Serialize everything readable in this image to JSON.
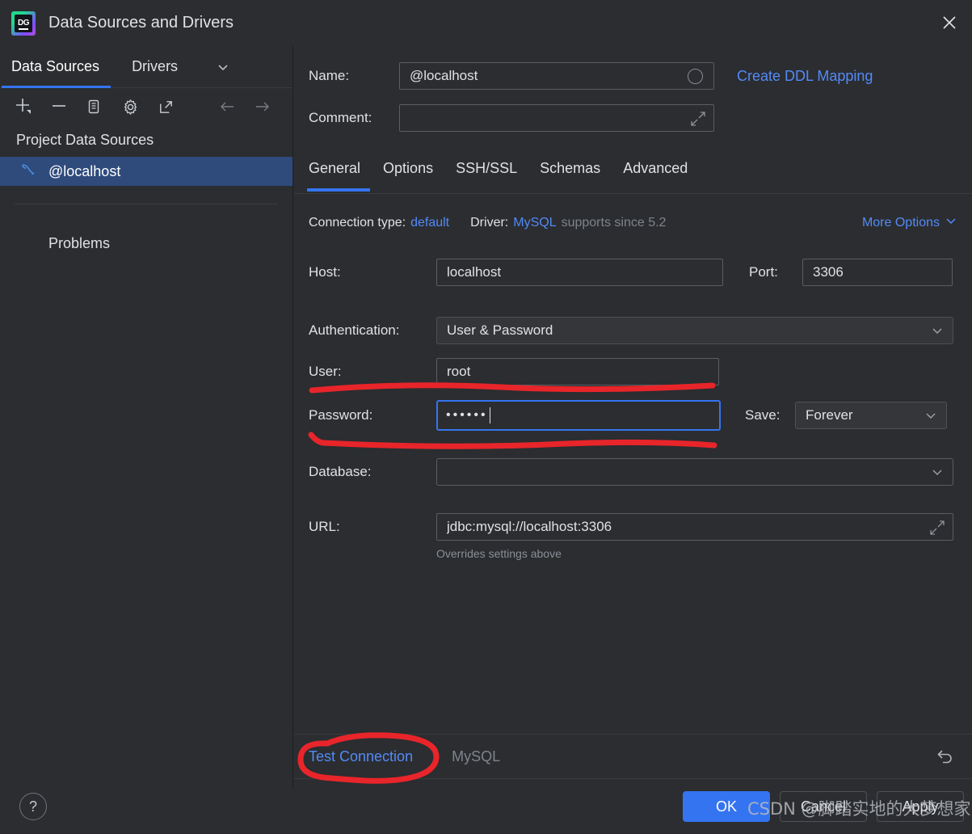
{
  "window": {
    "title": "Data Sources and Drivers",
    "logo_text": "DG",
    "close_icon": "close-icon"
  },
  "sidebar": {
    "tabs": [
      {
        "label": "Data Sources",
        "active": true
      },
      {
        "label": "Drivers",
        "active": false
      }
    ],
    "toolbar": [
      {
        "name": "add-icon",
        "title": "+"
      },
      {
        "name": "remove-icon",
        "title": "−"
      },
      {
        "name": "duplicate-icon",
        "title": "copy"
      },
      {
        "name": "settings-gear-icon",
        "title": "gear"
      },
      {
        "name": "external-link-icon",
        "title": "open"
      },
      {
        "name": "back-arrow-icon",
        "title": "←"
      },
      {
        "name": "forward-arrow-icon",
        "title": "→"
      }
    ],
    "group_title": "Project Data Sources",
    "data_sources": [
      {
        "label": "@localhost",
        "icon": "mysql-dolphin-icon",
        "selected": true
      }
    ],
    "problems_label": "Problems",
    "help_label": "?"
  },
  "form": {
    "name_label": "Name:",
    "name_value": "@localhost",
    "name_placeholder": "",
    "ddl_link": "Create DDL Mapping",
    "comment_label": "Comment:",
    "comment_value": "",
    "comment_placeholder": ""
  },
  "tabs": [
    {
      "label": "General",
      "active": true
    },
    {
      "label": "Options",
      "active": false
    },
    {
      "label": "SSH/SSL",
      "active": false
    },
    {
      "label": "Schemas",
      "active": false
    },
    {
      "label": "Advanced",
      "active": false
    }
  ],
  "connection": {
    "conn_type_label": "Connection type:",
    "conn_type_value": "default",
    "driver_label": "Driver:",
    "driver_value": "MySQL",
    "driver_note": "supports since 5.2",
    "more_options": "More Options",
    "host_label": "Host:",
    "host_value": "localhost",
    "port_label": "Port:",
    "port_value": "3306",
    "auth_label": "Authentication:",
    "auth_value": "User & Password",
    "user_label": "User:",
    "user_value": "root",
    "password_label": "Password:",
    "password_value": "••••••",
    "save_label": "Save:",
    "save_value": "Forever",
    "database_label": "Database:",
    "database_value": "",
    "url_label": "URL:",
    "url_value": "jdbc:mysql://localhost:3306",
    "url_hint": "Overrides settings above"
  },
  "footer": {
    "test_connection": "Test Connection",
    "driver_name": "MySQL",
    "revert_icon": "undo-icon",
    "ok": "OK",
    "cancel": "Cancel",
    "apply": "Apply"
  },
  "watermark": "CSDN @脚踏实地的大梦想家",
  "colors": {
    "accent": "#3574f0",
    "link": "#548af7",
    "background": "#2b2d30",
    "selected_row": "#2f4b7c",
    "annotation_red": "#e8252a"
  }
}
